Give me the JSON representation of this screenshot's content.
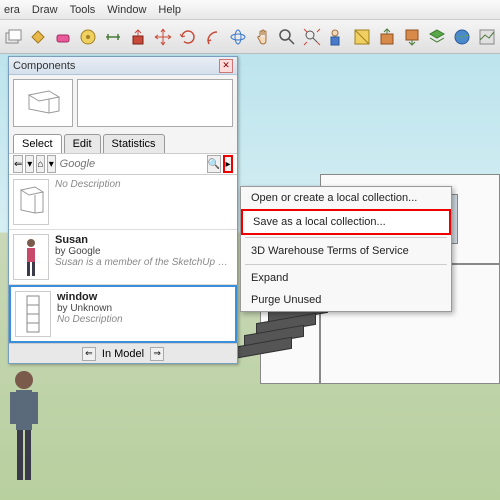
{
  "menu": {
    "items": [
      "era",
      "Draw",
      "Tools",
      "Window",
      "Help"
    ]
  },
  "panel": {
    "title": "Components",
    "tabs": {
      "select": "Select",
      "edit": "Edit",
      "stats": "Statistics"
    },
    "search": {
      "placeholder": "Google",
      "home_icon": "⌂",
      "dropdown_icon": "▾",
      "search_icon": "🔍",
      "details_icon": "▸"
    },
    "items": [
      {
        "name": "",
        "author": "",
        "desc": "No Description"
      },
      {
        "name": "Susan",
        "author": "by Google",
        "desc": "Susan is a member of the SketchUp development t..."
      },
      {
        "name": "window",
        "author": "by Unknown",
        "desc": "No Description"
      }
    ],
    "footer": {
      "label": "In Model",
      "left": "⇐",
      "right": "⇒"
    }
  },
  "context": {
    "items": [
      "Open or create a local collection...",
      "Save as a local collection...",
      "3D Warehouse Terms of Service",
      "Expand",
      "Purge Unused"
    ]
  }
}
